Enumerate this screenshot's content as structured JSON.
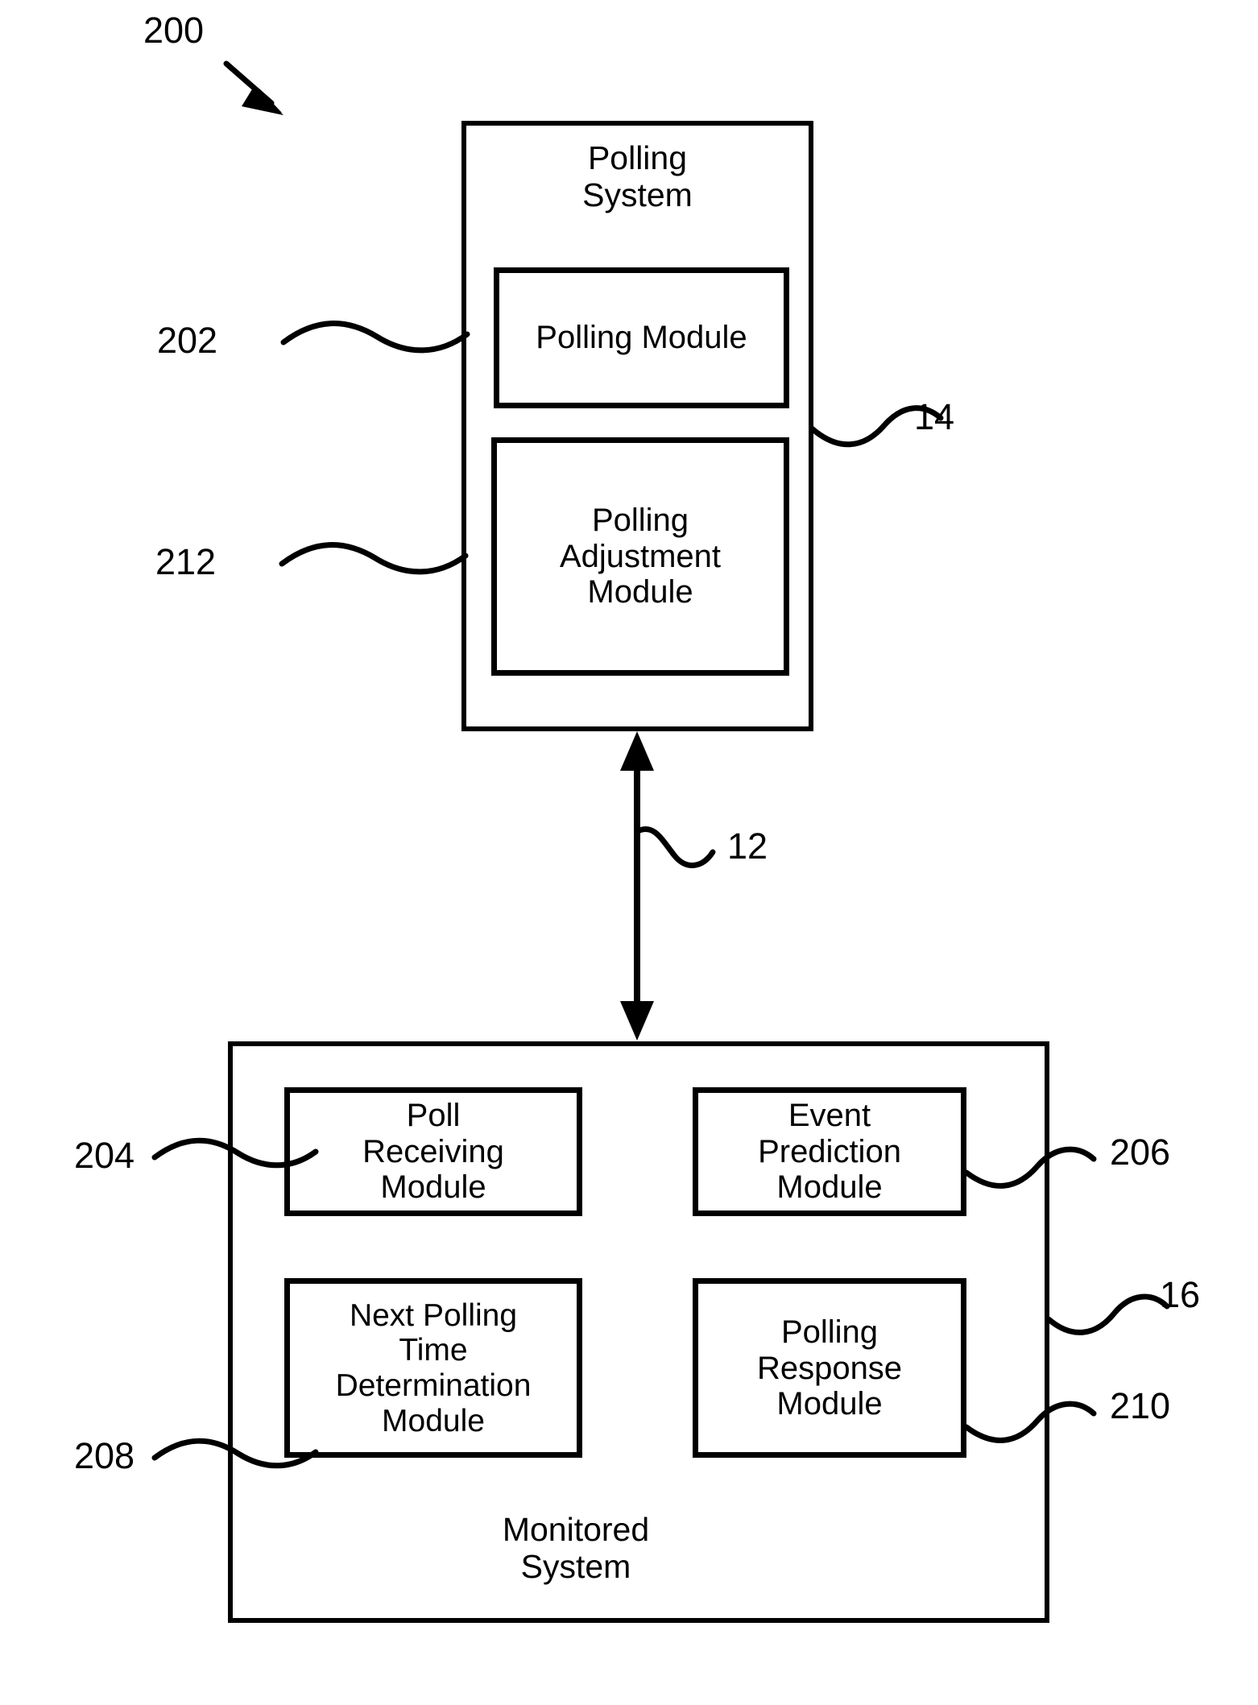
{
  "figure": {
    "number": "200",
    "type": "patent-block-diagram",
    "caption_number": "200"
  },
  "polling_system": {
    "title": "Polling\nSystem",
    "ref": "14",
    "modules": [
      {
        "label": "Polling Module",
        "ref": "202"
      },
      {
        "label": "Polling\nAdjustment\nModule",
        "ref": "212"
      }
    ]
  },
  "connection": {
    "ref": "12",
    "arrow": "double-headed-vertical"
  },
  "monitored_system": {
    "title": "Monitored\nSystem",
    "ref": "16",
    "modules": [
      {
        "label": "Poll\nReceiving\nModule",
        "ref": "204"
      },
      {
        "label": "Event\nPrediction\nModule",
        "ref": "206"
      },
      {
        "label": "Next Polling\nTime\nDetermination\nModule",
        "ref": "208"
      },
      {
        "label": "Polling\nResponse\nModule",
        "ref": "210"
      }
    ]
  },
  "colors": {
    "stroke": "#000000",
    "background": "#ffffff"
  }
}
